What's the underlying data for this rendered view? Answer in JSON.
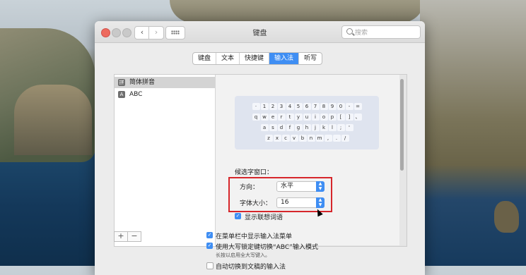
{
  "window": {
    "title": "键盘"
  },
  "search": {
    "placeholder": "搜索"
  },
  "nav": {
    "back": "‹",
    "forward": "›"
  },
  "tabs": [
    {
      "label": "键盘",
      "active": false
    },
    {
      "label": "文本",
      "active": false
    },
    {
      "label": "快捷键",
      "active": false
    },
    {
      "label": "输入法",
      "active": true
    },
    {
      "label": "听写",
      "active": false
    }
  ],
  "sources": [
    {
      "icon": "拼",
      "label": "简体拼音",
      "selected": true
    },
    {
      "icon": "A",
      "label": "ABC",
      "selected": false
    }
  ],
  "list_buttons": {
    "add": "+",
    "remove": "−"
  },
  "keyboard_rows": [
    [
      "·",
      "1",
      "2",
      "3",
      "4",
      "5",
      "6",
      "7",
      "8",
      "9",
      "0",
      "-",
      "="
    ],
    [
      "q",
      "w",
      "e",
      "r",
      "t",
      "y",
      "u",
      "i",
      "o",
      "p",
      "[",
      "]",
      "、"
    ],
    [
      "a",
      "s",
      "d",
      "f",
      "g",
      "h",
      "j",
      "k",
      "l",
      ";",
      "'"
    ],
    [
      "z",
      "x",
      "c",
      "v",
      "b",
      "n",
      "m",
      ",",
      ".",
      "/"
    ]
  ],
  "candidate": {
    "section_label": "候选字窗口：",
    "direction_label": "方向：",
    "direction_value": "水平",
    "fontsize_label": "字体大小：",
    "fontsize_value": "16"
  },
  "options": {
    "show_associated": "显示联想词语",
    "show_menu": "在菜单栏中显示输入法菜单",
    "capslock": "使用大写锁定键切换“ABC”输入模式",
    "capslock_note": "长按以启用全大写键入。",
    "auto_switch": "自动切换到文稿的输入法"
  },
  "colors": {
    "accent": "#3f8ef3",
    "highlight_box": "#d6262b"
  }
}
